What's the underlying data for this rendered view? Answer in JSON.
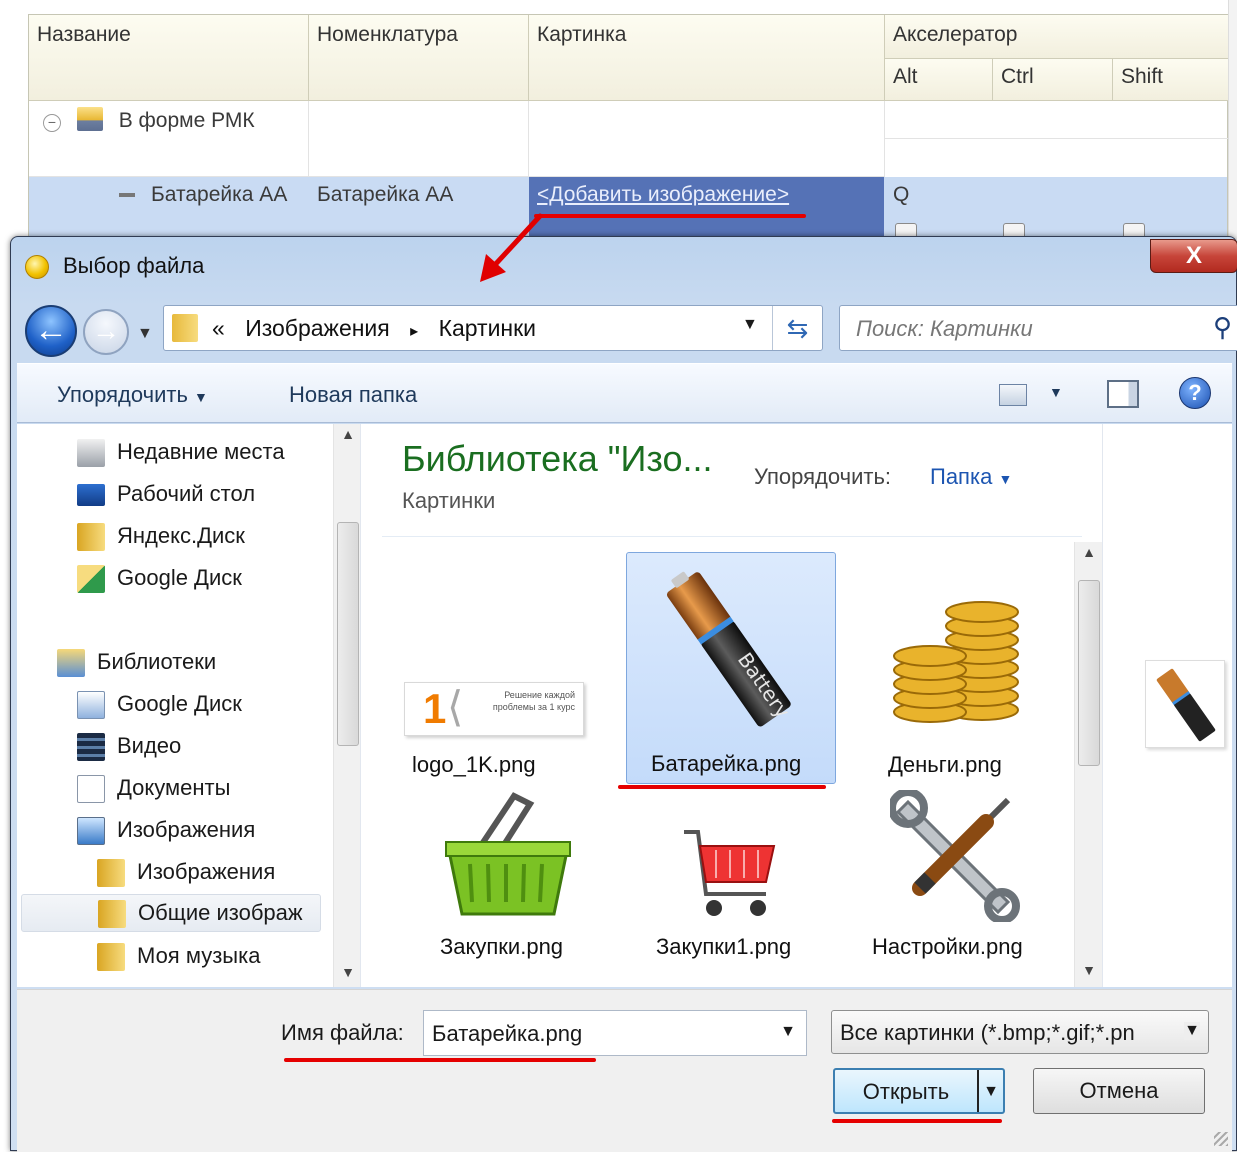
{
  "grid": {
    "headers": {
      "name": "Название",
      "nomenclature": "Номенклатура",
      "picture": "Картинка",
      "accelerator": "Акселератор",
      "alt": "Alt",
      "ctrl": "Ctrl",
      "shift": "Shift"
    },
    "group_row": {
      "name": "В форме РМК"
    },
    "selected_row": {
      "name": "Батарейка АА",
      "nomenclature": "Батарейка АА",
      "picture_link": "<Добавить изображение>",
      "accelerator_key": "Q"
    }
  },
  "dialog": {
    "title": "Выбор файла",
    "close_label": "X",
    "breadcrumb": {
      "prefix": "«",
      "items": [
        "Изображения",
        "Картинки"
      ],
      "separator": "▸"
    },
    "search_placeholder": "Поиск: Картинки",
    "toolbar": {
      "organize": "Упорядочить",
      "new_folder": "Новая папка"
    },
    "nav": [
      {
        "label": "Недавние места",
        "icon": "recent-places-icon"
      },
      {
        "label": "Рабочий стол",
        "icon": "desktop-icon"
      },
      {
        "label": "Яндекс.Диск",
        "icon": "folder-icon"
      },
      {
        "label": "Google Диск",
        "icon": "google-drive-folder-icon"
      },
      {
        "label": "Библиотеки",
        "icon": "libraries-icon"
      },
      {
        "label": "Google Диск",
        "icon": "library-doc-icon"
      },
      {
        "label": "Видео",
        "icon": "video-icon"
      },
      {
        "label": "Документы",
        "icon": "documents-icon"
      },
      {
        "label": "Изображения",
        "icon": "pictures-icon"
      },
      {
        "label": "Изображения",
        "icon": "pictures-folder-icon"
      },
      {
        "label": "Общие изображ",
        "icon": "folder-icon"
      },
      {
        "label": "Моя музыка",
        "icon": "music-folder-icon"
      }
    ],
    "library": {
      "title": "Библиотека \"Изо...",
      "subtitle": "Картинки",
      "arrange_label": "Упорядочить:",
      "arrange_value": "Папка"
    },
    "files": [
      {
        "name": "logo_1K.png"
      },
      {
        "name": "Батарейка.png",
        "selected": true
      },
      {
        "name": "Деньги.png"
      },
      {
        "name": "Закупки.png"
      },
      {
        "name": "Закупки1.png"
      },
      {
        "name": "Настройки.png"
      }
    ],
    "logo_caption": "Решение каждой проблемы за 1 курс",
    "battery_text": "Battery",
    "bottom": {
      "file_name_label": "Имя файла:",
      "file_name_value": "Батарейка.png",
      "filter_value": "Все картинки (*.bmp;*.gif;*.pn",
      "open_label": "Открыть",
      "cancel_label": "Отмена"
    }
  },
  "colors": {
    "highlight": "#e50000",
    "selection": "#c9dbf3",
    "link_cell": "#5572b6",
    "library_title": "#1a6e20"
  }
}
